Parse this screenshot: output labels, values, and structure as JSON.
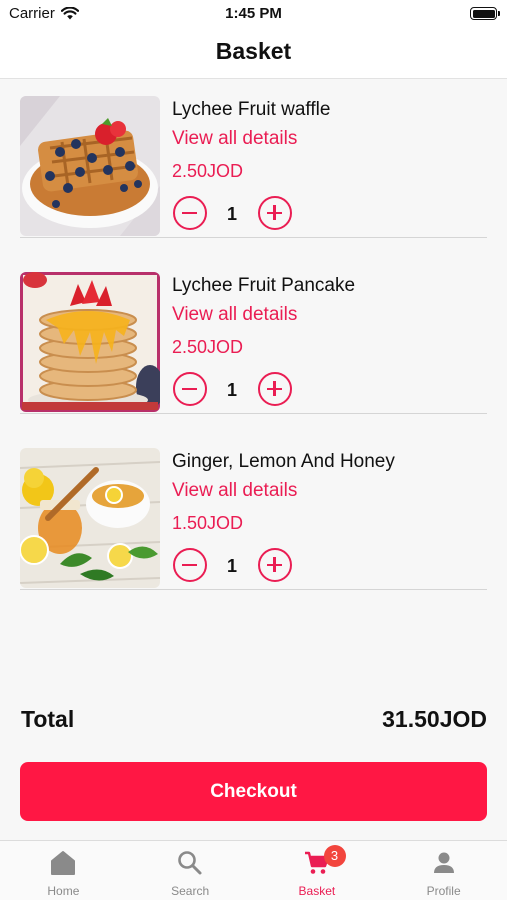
{
  "status": {
    "carrier": "Carrier",
    "time": "1:45 PM"
  },
  "header": {
    "title": "Basket"
  },
  "basket": {
    "link_label": "View all details",
    "items": [
      {
        "name": "Lychee Fruit waffle",
        "price": "2.50JOD",
        "quantity": "1"
      },
      {
        "name": "Lychee Fruit Pancake",
        "price": "2.50JOD",
        "quantity": "1"
      },
      {
        "name": "Ginger, Lemon And Honey",
        "price": "1.50JOD",
        "quantity": "1"
      }
    ]
  },
  "summary": {
    "total_label": "Total",
    "total_value": "31.50JOD"
  },
  "checkout": {
    "label": "Checkout"
  },
  "tabs": [
    {
      "label": "Home",
      "icon": "home-icon"
    },
    {
      "label": "Search",
      "icon": "search-icon"
    },
    {
      "label": "Basket",
      "icon": "cart-icon",
      "badge": "3",
      "active": true
    },
    {
      "label": "Profile",
      "icon": "person-icon"
    }
  ],
  "colors": {
    "accent": "#ea1d53",
    "checkout_bg": "#ff1744",
    "badge_bg": "#f2453d",
    "inactive_tab": "#8a8a8a"
  }
}
